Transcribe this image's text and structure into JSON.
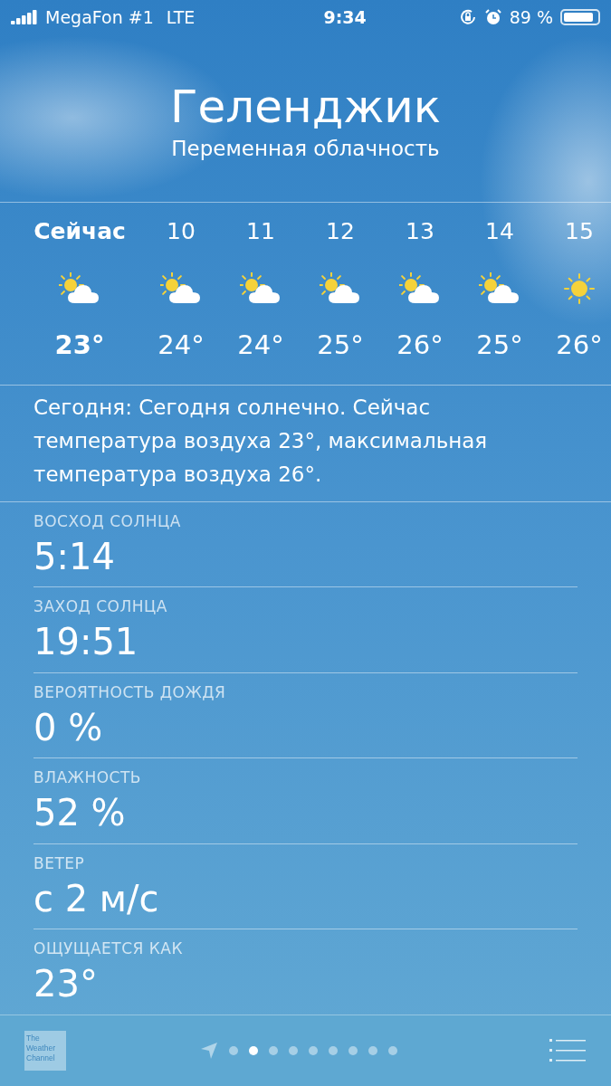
{
  "status_bar": {
    "carrier": "MegaFon #1",
    "network": "LTE",
    "time": "9:34",
    "battery_text": "89 %",
    "battery": {
      "level": 0.89
    }
  },
  "header": {
    "city": "Геленджик",
    "condition": "Переменная облачность"
  },
  "hourly": [
    {
      "label": "Сейчас",
      "kind": "partly",
      "temp": "23°",
      "current": true
    },
    {
      "label": "10",
      "kind": "partly",
      "temp": "24°",
      "current": false
    },
    {
      "label": "11",
      "kind": "partly",
      "temp": "24°",
      "current": false
    },
    {
      "label": "12",
      "kind": "partly",
      "temp": "25°",
      "current": false
    },
    {
      "label": "13",
      "kind": "partly",
      "temp": "26°",
      "current": false
    },
    {
      "label": "14",
      "kind": "partly",
      "temp": "25°",
      "current": false
    },
    {
      "label": "15",
      "kind": "sunny",
      "temp": "26°",
      "current": false
    }
  ],
  "summary": "Сегодня: Сегодня солнечно. Сейчас температура воздуха 23°, максимальная температура воздуха 26°.",
  "details": [
    {
      "label": "ВОСХОД СОЛНЦА",
      "value": "5:14"
    },
    {
      "label": "ЗАХОД СОЛНЦА",
      "value": "19:51"
    },
    {
      "label": "ВЕРОЯТНОСТЬ ДОЖДЯ",
      "value": "0 %"
    },
    {
      "label": "ВЛАЖНОСТЬ",
      "value": "52 %"
    },
    {
      "label": "ВЕТЕР",
      "value": "с 2 м/с"
    },
    {
      "label": "ОЩУЩАЕТСЯ КАК",
      "value": "23°"
    }
  ],
  "bottom_bar": {
    "logo": "The Weather Channel",
    "pages": [
      {
        "selected": false
      },
      {
        "selected": true
      },
      {
        "selected": false
      },
      {
        "selected": false
      },
      {
        "selected": false
      },
      {
        "selected": false
      },
      {
        "selected": false
      },
      {
        "selected": false
      },
      {
        "selected": false
      }
    ]
  }
}
